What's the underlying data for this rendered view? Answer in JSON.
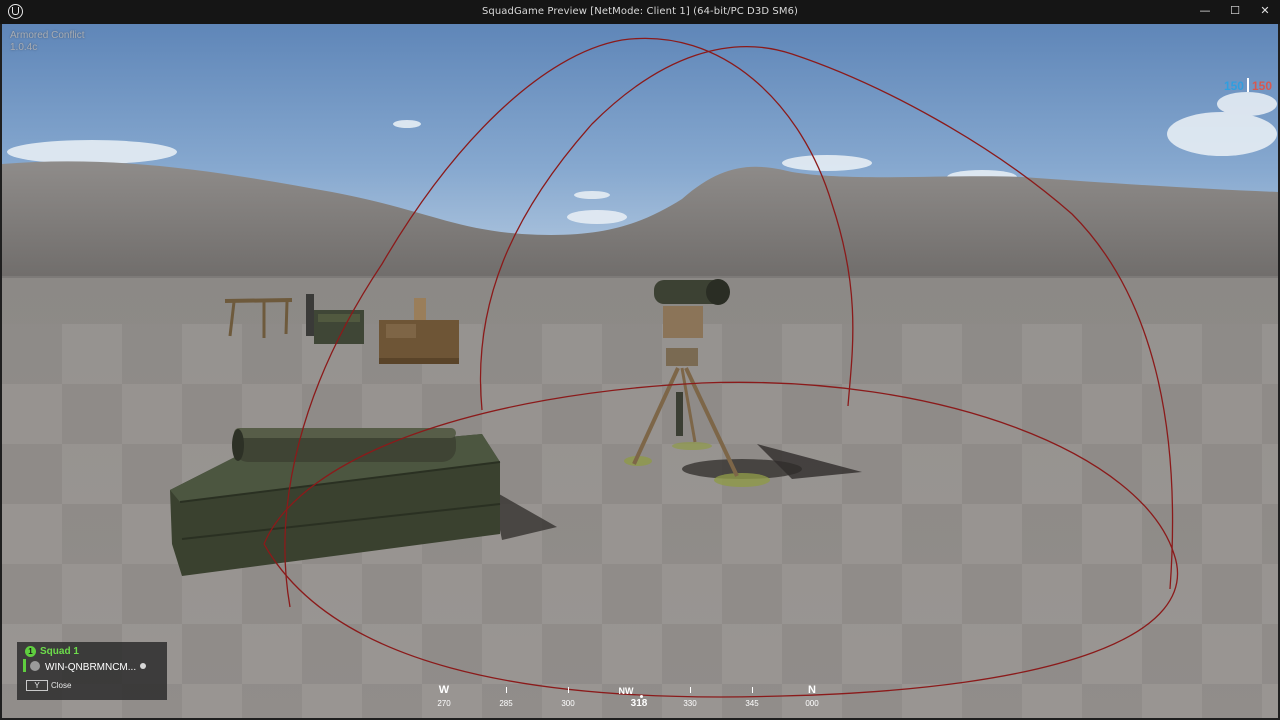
{
  "window": {
    "title": "SquadGame Preview [NetMode: Client 1]  (64-bit/PC D3D SM6)",
    "minimize_glyph": "—",
    "maximize_glyph": "☐",
    "close_glyph": "✕"
  },
  "hud": {
    "game_name": "Armored Conflict",
    "version": "1.0.4c",
    "score_blue": "150",
    "score_red": "150",
    "team_colors": {
      "blue": "#2f9fe0",
      "red": "#d8584f"
    }
  },
  "squad_panel": {
    "squad_number": "1",
    "squad_label": "Squad 1",
    "member_name": "WIN-QNBRMNCM...",
    "close_key": "Y",
    "close_label": "Close"
  },
  "compass": {
    "heading": "318",
    "cardinals": [
      {
        "label": "W",
        "value": "270"
      },
      {
        "label": "NW",
        "value": "318"
      },
      {
        "label": "N",
        "value": "000"
      }
    ],
    "tick_values": [
      "285",
      "300",
      "330",
      "345"
    ]
  }
}
